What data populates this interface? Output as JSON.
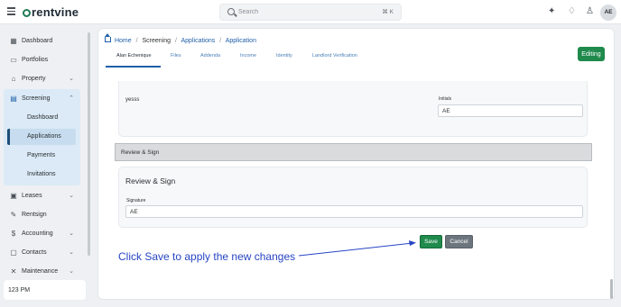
{
  "app": {
    "logo_text": "rentvine"
  },
  "search": {
    "placeholder": "Search",
    "shortcut": "⌘ K"
  },
  "user": {
    "initials": "AE"
  },
  "sidebar": {
    "items": [
      {
        "label": "Dashboard",
        "icon": "dashboard-icon"
      },
      {
        "label": "Portfolios",
        "icon": "folder-icon"
      },
      {
        "label": "Property",
        "icon": "chart-icon"
      },
      {
        "label": "Screening",
        "icon": "document-icon"
      },
      {
        "label": "Leases",
        "icon": "lease-icon"
      },
      {
        "label": "Rentsign",
        "icon": "sign-icon"
      },
      {
        "label": "Accounting",
        "icon": "dollar-icon"
      },
      {
        "label": "Contacts",
        "icon": "contacts-icon"
      },
      {
        "label": "Maintenance",
        "icon": "wrench-icon"
      }
    ],
    "screening_sub": [
      {
        "label": "Dashboard"
      },
      {
        "label": "Applications"
      },
      {
        "label": "Payments"
      },
      {
        "label": "Invitations"
      }
    ],
    "time": "123 PM"
  },
  "breadcrumb": {
    "home": "Home",
    "screening": "Screening",
    "applications": "Applications",
    "application": "Application"
  },
  "tabs": [
    "Alan Echenique",
    "Files",
    "Addenda",
    "Income",
    "Identity",
    "Landlord Verification"
  ],
  "editing_label": "Editing",
  "form": {
    "text_value": "yesss",
    "initials_label": "Initials",
    "initials_value": "AE",
    "section_title": "Review & Sign",
    "card_heading": "Review & Sign",
    "signature_label": "Signature",
    "signature_value": "AE"
  },
  "actions": {
    "save": "Save",
    "cancel": "Cancel"
  },
  "annotation": {
    "text": "Click Save to apply the new changes",
    "color": "#2745c4"
  }
}
